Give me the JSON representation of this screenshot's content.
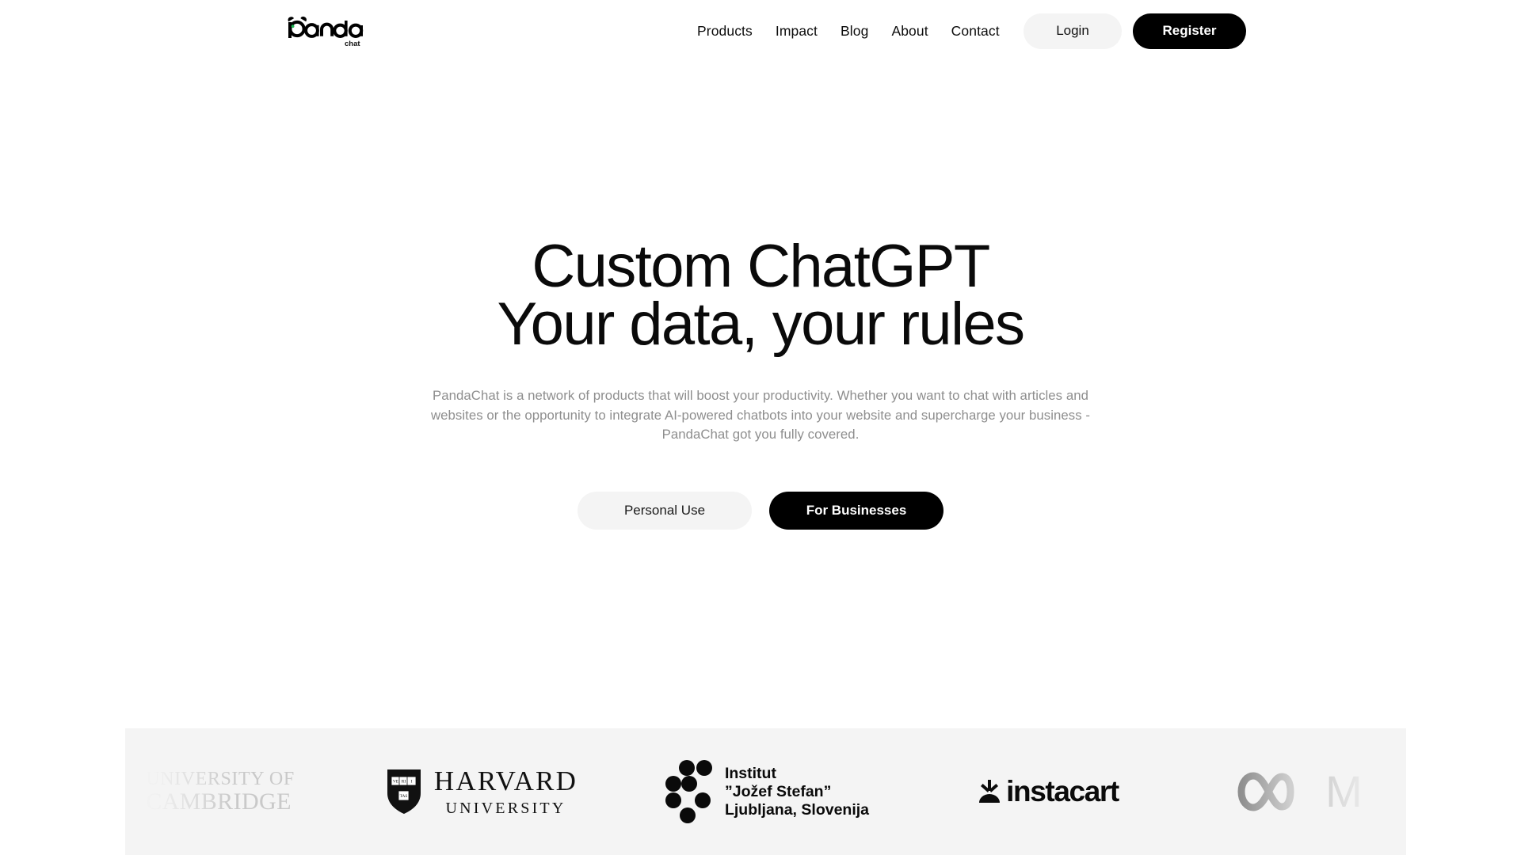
{
  "brand": {
    "logo_wordmark": "panda",
    "logo_sub": "chat",
    "accent_green": "#1db954",
    "logo_icon": "panda-logo-icon"
  },
  "header": {
    "nav": [
      {
        "label": "Products"
      },
      {
        "label": "Impact"
      },
      {
        "label": "Blog"
      },
      {
        "label": "About"
      },
      {
        "label": "Contact"
      }
    ],
    "login_label": "Login",
    "register_label": "Register",
    "login_bg": "#f4f4f4",
    "register_bg": "#000000"
  },
  "hero": {
    "title_line1": "Custom ChatGPT",
    "title_line2": "Your data, your rules",
    "subtitle": "PandaChat is a network of products that will boost your productivity. Whether you want to chat with articles and websites or the opportunity to integrate AI-powered chatbots into your website and supercharge your business - PandaChat got you fully covered.",
    "cta_personal": "Personal Use",
    "cta_business": "For Businesses",
    "subtitle_color": "#8e8e8e"
  },
  "logo_strip": {
    "background": "#f4f4f4",
    "logos": [
      {
        "name": "university-of-cambridge",
        "line1": "UNIVERSITY OF",
        "line2": "CAMBRIDGE",
        "color": "#c9c9c9"
      },
      {
        "name": "harvard-university",
        "line1": "HARVARD",
        "line2": "UNIVERSITY",
        "shield_words": [
          "VE",
          "RI",
          "TAS"
        ],
        "color": "#111111"
      },
      {
        "name": "institut-jozef-stefan",
        "line1": "Institut",
        "line2": "”Jožef Stefan”",
        "line3": "Ljubljana, Slovenija",
        "color": "#0a0a0a"
      },
      {
        "name": "instacart",
        "wordmark": "instacart",
        "color": "#0b0b0b"
      },
      {
        "name": "meta",
        "wordmark": "M",
        "color": "#c3c3c3"
      }
    ]
  }
}
